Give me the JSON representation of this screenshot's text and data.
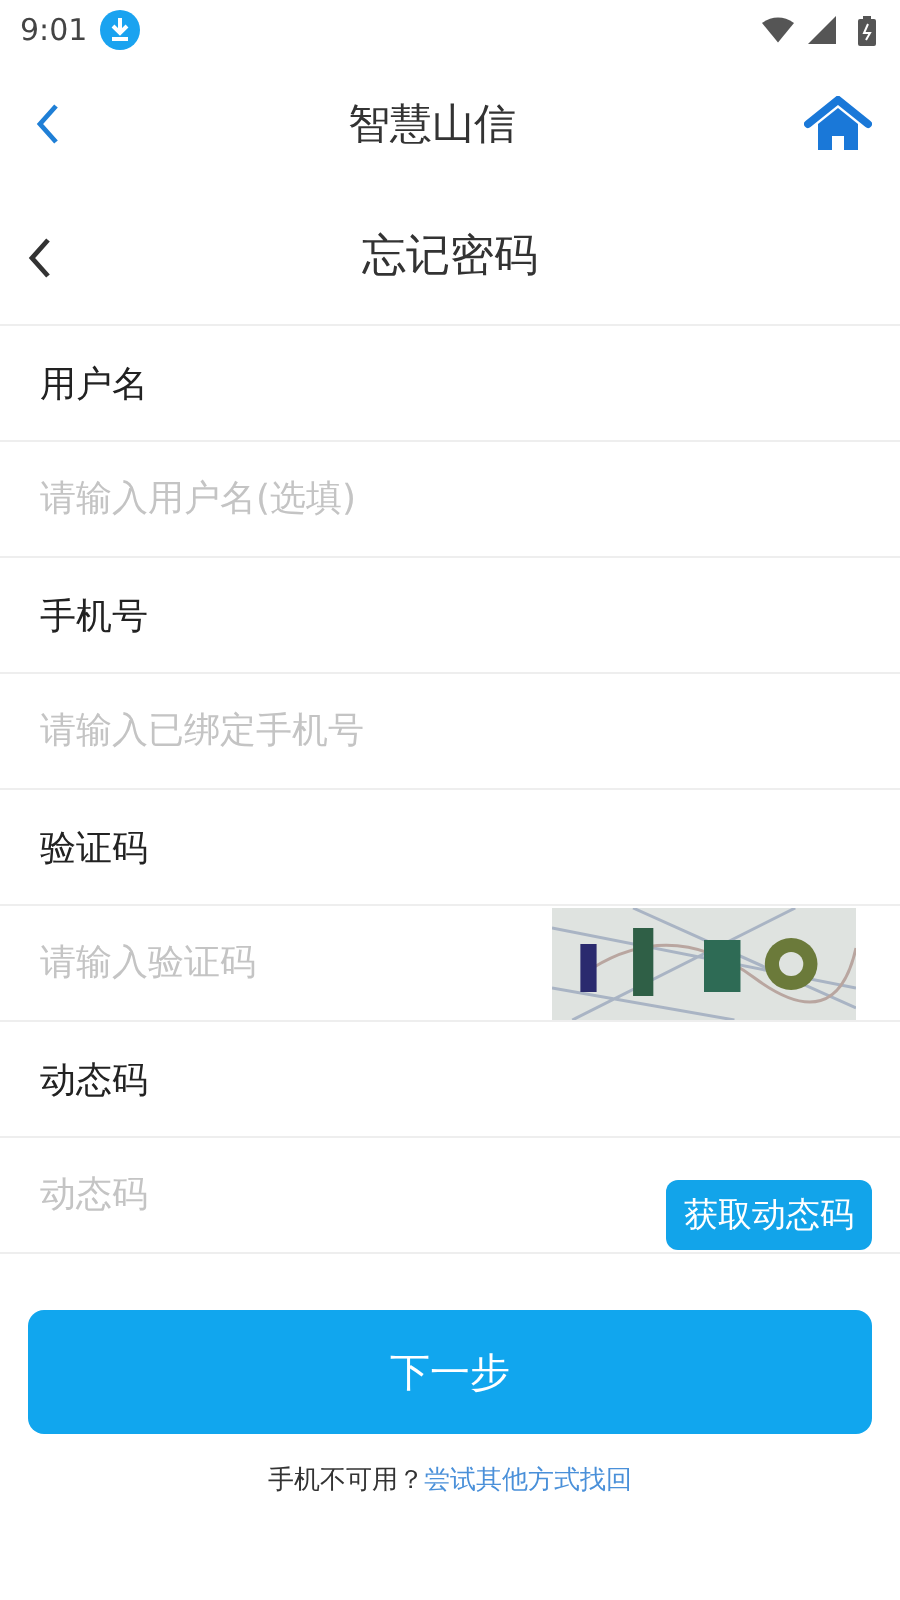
{
  "status_bar": {
    "time": "9:01"
  },
  "app_bar": {
    "title": "智慧山信"
  },
  "page_header": {
    "title": "忘记密码"
  },
  "fields": [
    {
      "kind": "text",
      "label": "用户名",
      "placeholder": "请输入用户名(选填)"
    },
    {
      "kind": "text",
      "label": "手机号",
      "placeholder": "请输入已绑定手机号"
    },
    {
      "kind": "captcha",
      "label": "验证码",
      "placeholder": "请输入验证码"
    },
    {
      "kind": "sms",
      "label": "动态码",
      "placeholder": "动态码",
      "button": "获取动态码"
    }
  ],
  "submit": {
    "label": "下一步"
  },
  "footer": {
    "text": "手机不可用？",
    "link": "尝试其他方式找回"
  }
}
